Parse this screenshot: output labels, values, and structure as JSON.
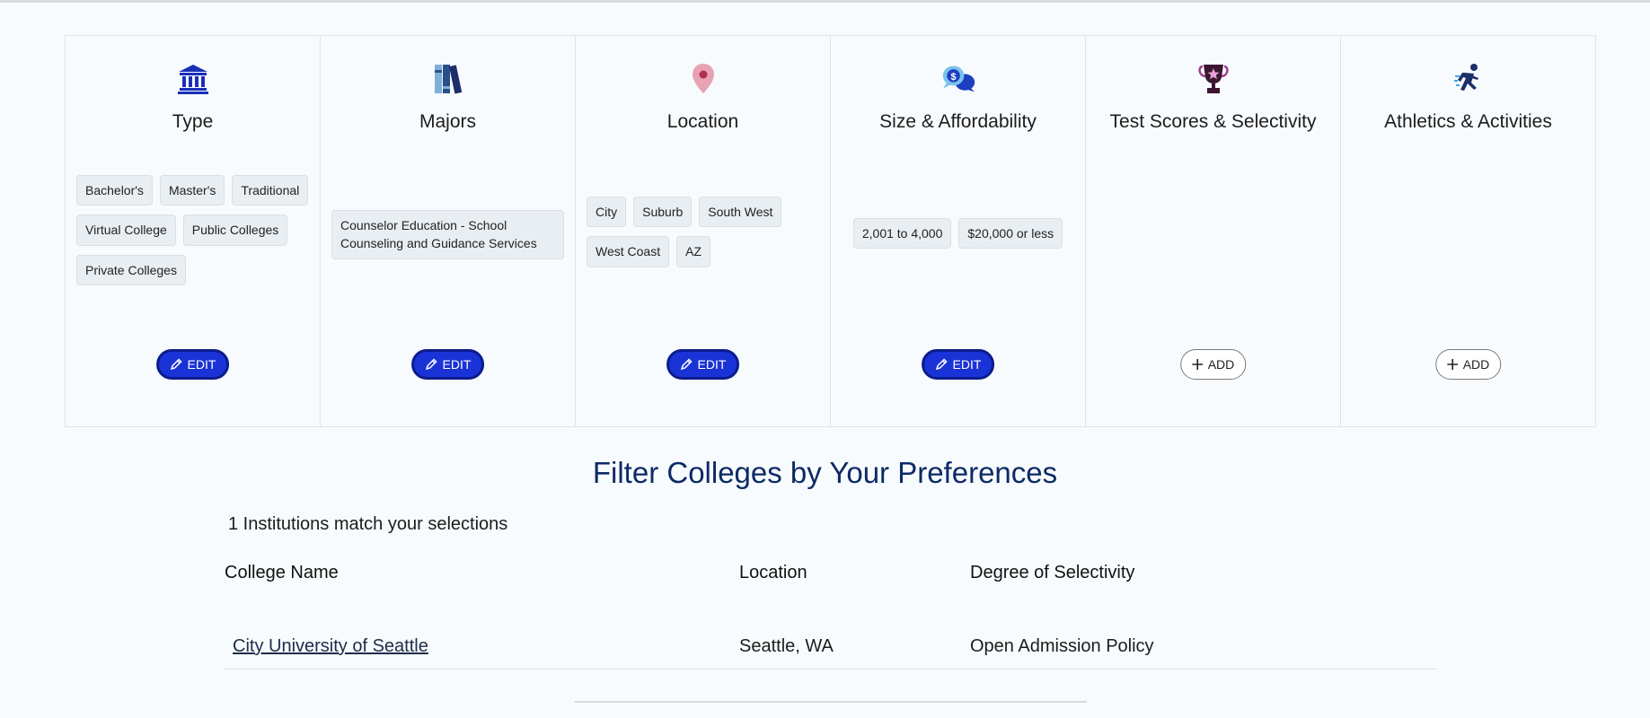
{
  "colors": {
    "accent": "#1a33d6",
    "title_blue": "#0d2a66",
    "chip_bg": "#e9eef2"
  },
  "cards": [
    {
      "icon": "bank-icon",
      "title": "Type",
      "chips": [
        "Bachelor's",
        "Master's",
        "Traditional",
        "Virtual College",
        "Public Colleges",
        "Private Colleges"
      ],
      "button": "EDIT"
    },
    {
      "icon": "books-icon",
      "title": "Majors",
      "chips": [
        "Counselor Education - School Counseling and Guidance Services"
      ],
      "button": "EDIT"
    },
    {
      "icon": "map-pin-icon",
      "title": "Location",
      "chips": [
        "City",
        "Suburb",
        "South West",
        "West Coast",
        "AZ"
      ],
      "button": "EDIT"
    },
    {
      "icon": "chat-dollar-icon",
      "title": "Size & Affordability",
      "chips": [
        "2,001 to 4,000",
        "$20,000 or less"
      ],
      "button": "EDIT"
    },
    {
      "icon": "trophy-icon",
      "title": "Test Scores & Selectivity",
      "chips": [],
      "button": "ADD"
    },
    {
      "icon": "runner-icon",
      "title": "Athletics & Activities",
      "chips": [],
      "button": "ADD"
    }
  ],
  "filter": {
    "title": "Filter Colleges by Your Preferences",
    "match_count": "1 Institutions match your selections"
  },
  "table": {
    "headers": [
      "College Name",
      "Location",
      "Degree of Selectivity"
    ],
    "rows": [
      [
        "City University of Seattle",
        "Seattle, WA",
        "Open Admission Policy"
      ]
    ]
  }
}
